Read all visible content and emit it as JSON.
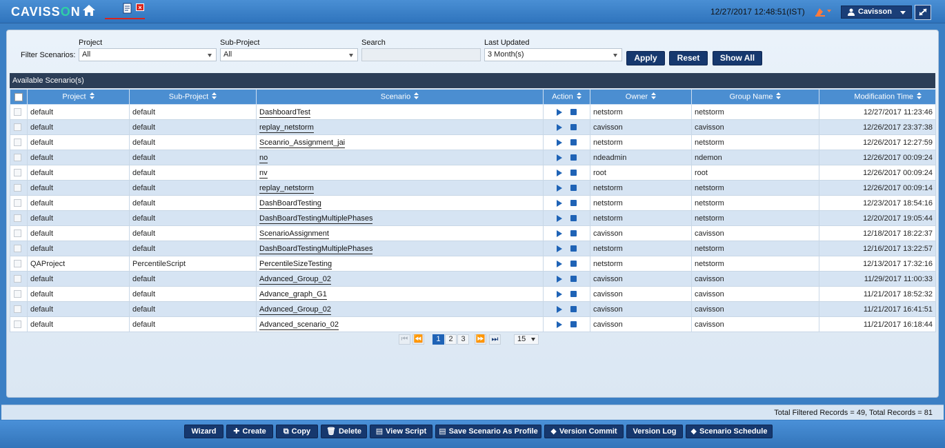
{
  "header": {
    "logo_prefix": "CAVISS",
    "logo_o": "O",
    "logo_suffix": "N",
    "datetime": "12/27/2017 12:48:51(IST)",
    "user_name": "Cavisson"
  },
  "filters": {
    "label": "Filter Scenarios:",
    "project_label": "Project",
    "project_value": "All",
    "subproject_label": "Sub-Project",
    "subproject_value": "All",
    "search_label": "Search",
    "search_value": "",
    "updated_label": "Last Updated",
    "updated_value": "3 Month(s)",
    "apply": "Apply",
    "reset": "Reset",
    "show_all": "Show All"
  },
  "grid": {
    "title": "Available Scenario(s)",
    "columns": {
      "project": "Project",
      "subproject": "Sub-Project",
      "scenario": "Scenario",
      "action": "Action",
      "owner": "Owner",
      "group": "Group Name",
      "modtime": "Modification Time"
    },
    "rows": [
      {
        "project": "default",
        "subproject": "default",
        "scenario": "DashboardTest",
        "owner": "netstorm",
        "group": "netstorm",
        "modtime": "12/27/2017 11:23:46"
      },
      {
        "project": "default",
        "subproject": "default",
        "scenario": "replay_netstorm",
        "owner": "cavisson",
        "group": "cavisson",
        "modtime": "12/26/2017 23:37:38"
      },
      {
        "project": "default",
        "subproject": "default",
        "scenario": "Sceanrio_Assignment_jai",
        "owner": "netstorm",
        "group": "netstorm",
        "modtime": "12/26/2017 12:27:59"
      },
      {
        "project": "default",
        "subproject": "default",
        "scenario": "no",
        "owner": "ndeadmin",
        "group": "ndemon",
        "modtime": "12/26/2017 00:09:24"
      },
      {
        "project": "default",
        "subproject": "default",
        "scenario": "nv",
        "owner": "root",
        "group": "root",
        "modtime": "12/26/2017 00:09:24"
      },
      {
        "project": "default",
        "subproject": "default",
        "scenario": "replay_netstorm",
        "owner": "netstorm",
        "group": "netstorm",
        "modtime": "12/26/2017 00:09:14"
      },
      {
        "project": "default",
        "subproject": "default",
        "scenario": "DashBoardTesting",
        "owner": "netstorm",
        "group": "netstorm",
        "modtime": "12/23/2017 18:54:16"
      },
      {
        "project": "default",
        "subproject": "default",
        "scenario": "DashBoardTestingMultiplePhases",
        "owner": "netstorm",
        "group": "netstorm",
        "modtime": "12/20/2017 19:05:44"
      },
      {
        "project": "default",
        "subproject": "default",
        "scenario": "ScenarioAssignment",
        "owner": "cavisson",
        "group": "cavisson",
        "modtime": "12/18/2017 18:22:37"
      },
      {
        "project": "default",
        "subproject": "default",
        "scenario": "DashBoardTestingMultiplePhases",
        "owner": "netstorm",
        "group": "netstorm",
        "modtime": "12/16/2017 13:22:57"
      },
      {
        "project": "QAProject",
        "subproject": "PercentileScript",
        "scenario": "PercentileSizeTesting",
        "owner": "netstorm",
        "group": "netstorm",
        "modtime": "12/13/2017 17:32:16"
      },
      {
        "project": "default",
        "subproject": "default",
        "scenario": "Advanced_Group_02",
        "owner": "cavisson",
        "group": "cavisson",
        "modtime": "11/29/2017 11:00:33"
      },
      {
        "project": "default",
        "subproject": "default",
        "scenario": "Advance_graph_G1",
        "owner": "cavisson",
        "group": "cavisson",
        "modtime": "11/21/2017 18:52:32"
      },
      {
        "project": "default",
        "subproject": "default",
        "scenario": "Advanced_Group_02",
        "owner": "cavisson",
        "group": "cavisson",
        "modtime": "11/21/2017 16:41:51"
      },
      {
        "project": "default",
        "subproject": "default",
        "scenario": "Advanced_scenario_02",
        "owner": "cavisson",
        "group": "cavisson",
        "modtime": "11/21/2017 16:18:44"
      }
    ]
  },
  "pager": {
    "pages": [
      "1",
      "2",
      "3"
    ],
    "current_page": "1",
    "page_size": "15"
  },
  "status": {
    "records": "Total Filtered Records = 49, Total Records = 81"
  },
  "actions": {
    "wizard": "Wizard",
    "create": "Create",
    "copy": "Copy",
    "delete": "Delete",
    "view_script": "View Script",
    "save_profile": "Save Scenario As Profile",
    "version_commit": "Version Commit",
    "version_log": "Version Log",
    "schedule": "Scenario Schedule"
  },
  "colors": {
    "accent": "#1f63b6",
    "header_bg": "#3b7fc4",
    "button_bg": "#16386e",
    "row_alt": "#d6e4f3"
  }
}
